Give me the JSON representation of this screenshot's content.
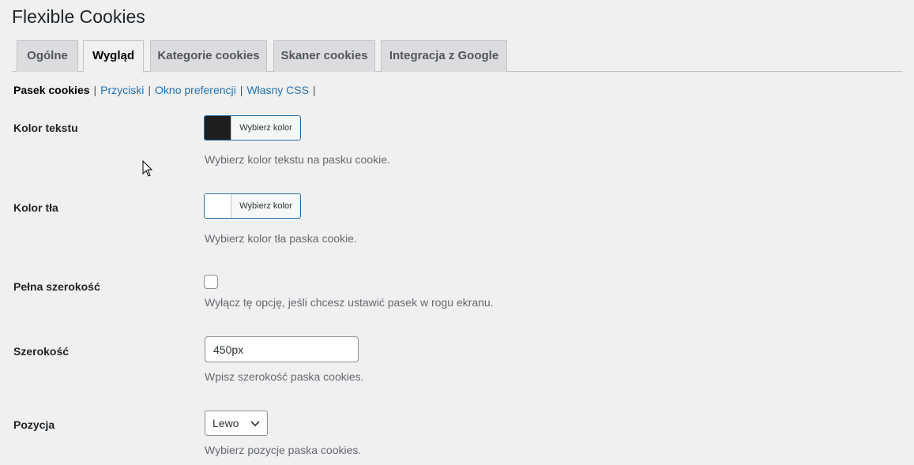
{
  "page": {
    "title": "Flexible Cookies"
  },
  "tabs": [
    {
      "label": "Ogólne",
      "active": false
    },
    {
      "label": "Wygląd",
      "active": true
    },
    {
      "label": "Kategorie cookies",
      "active": false
    },
    {
      "label": "Skaner cookies",
      "active": false
    },
    {
      "label": "Integracja z Google",
      "active": false
    }
  ],
  "subnav": {
    "current": "Pasek cookies",
    "links": [
      "Przyciski",
      "Okno preferencji",
      "Własny CSS"
    ],
    "separator": "|"
  },
  "fields": {
    "text_color": {
      "label": "Kolor tekstu",
      "button_label": "Wybierz kolor",
      "swatch_color": "#1e1e1e",
      "description": "Wybierz kolor tekstu na pasku cookie."
    },
    "bg_color": {
      "label": "Kolor tła",
      "button_label": "Wybierz kolor",
      "swatch_color": "#ffffff",
      "description": "Wybierz kolor tła paska cookie."
    },
    "full_width": {
      "label": "Pełna szerokość",
      "checked": false,
      "description": "Wyłącz tę opcję, jeśli chcesz ustawić pasek w rogu ekranu."
    },
    "width": {
      "label": "Szerokość",
      "value": "450px",
      "description": "Wpisz szerokość paska cookies."
    },
    "position": {
      "label": "Pozycja",
      "selected": "Lewo",
      "description": "Wybierz pozycje paska cookies."
    }
  },
  "colors": {
    "link": "#2271b1",
    "tab_bg": "#dcdcde",
    "page_bg": "#f0f0f1"
  }
}
